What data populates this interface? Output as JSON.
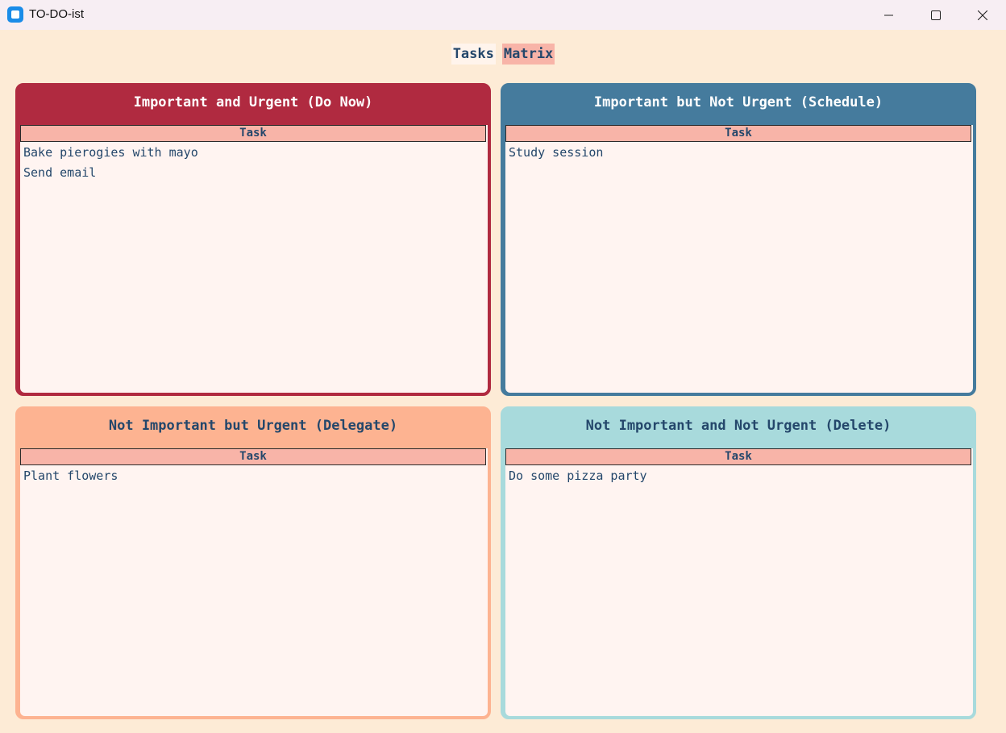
{
  "window": {
    "title": "TO-DO-ist",
    "icon": "app-icon"
  },
  "nav": {
    "tasks_label": "Tasks",
    "matrix_label": "Matrix",
    "active": "Matrix"
  },
  "quadrants": [
    {
      "title": "Important and Urgent (Do Now)",
      "color": "#b02a40",
      "column_header": "Task",
      "tasks": [
        "Bake pierogies with mayo",
        "Send email"
      ]
    },
    {
      "title": "Important but Not Urgent (Schedule)",
      "color": "#457b9d",
      "column_header": "Task",
      "tasks": [
        "Study session"
      ]
    },
    {
      "title": "Not Important but Urgent (Delegate)",
      "color": "#fdb391",
      "column_header": "Task",
      "tasks": [
        "Plant flowers"
      ]
    },
    {
      "title": "Not Important and Not Urgent (Delete)",
      "color": "#a8dadc",
      "column_header": "Task",
      "tasks": [
        "Do some pizza party"
      ]
    }
  ]
}
